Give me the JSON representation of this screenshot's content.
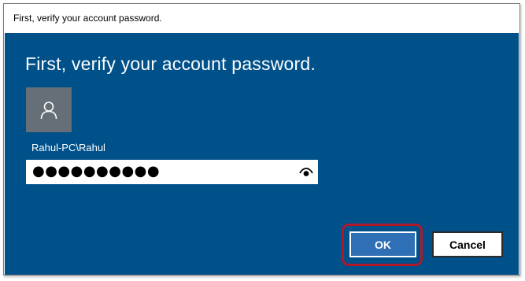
{
  "window": {
    "title": "First, verify your account password."
  },
  "dialog": {
    "heading": "First, verify your account password.",
    "account": {
      "avatar_icon": "user-icon",
      "username": "Rahul-PC\\Rahul"
    },
    "password_field": {
      "masked_value": "●●●●●●●●●●",
      "reveal_icon": "eye-icon"
    },
    "buttons": {
      "ok_label": "OK",
      "cancel_label": "Cancel"
    }
  },
  "colors": {
    "dialog_background": "#00508a",
    "avatar_background": "#666f78",
    "ok_button": "#2e6fb5",
    "highlight_annotation": "#b0182a"
  }
}
